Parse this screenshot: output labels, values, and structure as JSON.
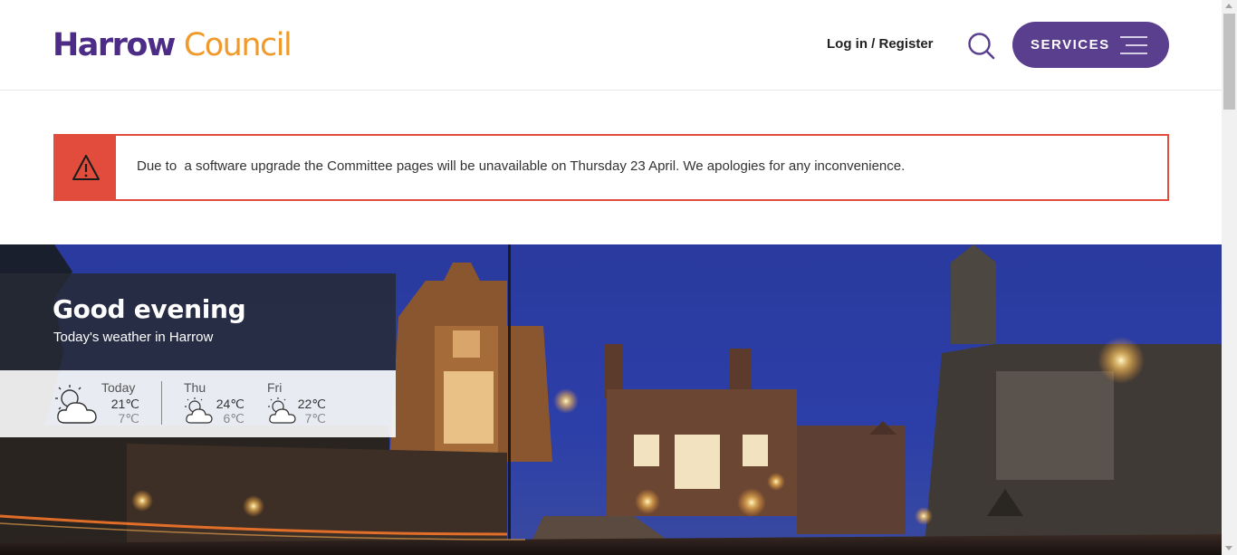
{
  "header": {
    "logo_part1": "Harrow",
    "logo_part2": "Council",
    "login_label": "Log in / Register",
    "services_label": "SERVICES",
    "search_icon": "search-icon",
    "menu_icon": "hamburger-icon"
  },
  "alert": {
    "icon": "warning-icon",
    "message": "Due to  a software upgrade the Committee pages will be unavailable on Thursday 23 April. We apologies for any inconvenience."
  },
  "hero": {
    "greeting": "Good evening",
    "subtitle": "Today's weather in Harrow",
    "forecast": [
      {
        "day": "Today",
        "high": "21℃",
        "low": "7℃",
        "icon": "partly-cloudy-icon"
      },
      {
        "day": "Thu",
        "high": "24℃",
        "low": "6℃",
        "icon": "partly-cloudy-icon"
      },
      {
        "day": "Fri",
        "high": "22℃",
        "low": "7℃",
        "icon": "partly-cloudy-icon"
      }
    ]
  },
  "colors": {
    "brand_purple": "#4c2c86",
    "brand_orange": "#f09a2b",
    "services_bg": "#5b3f8f",
    "alert_red": "#e24c3d"
  }
}
